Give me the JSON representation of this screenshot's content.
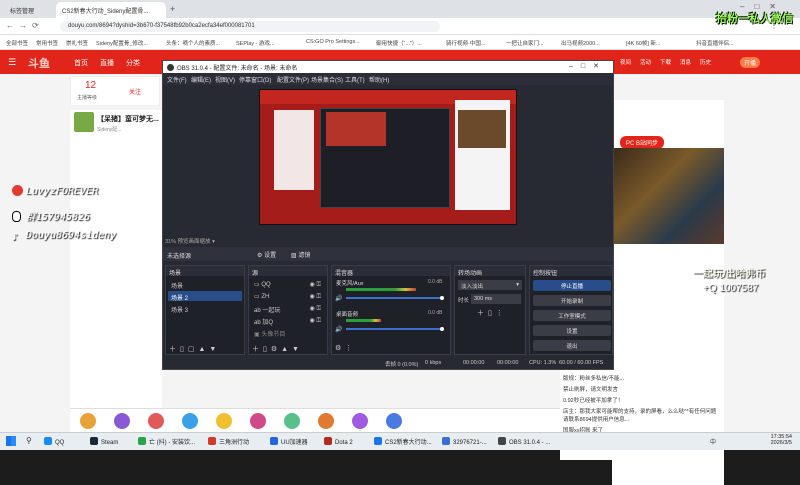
{
  "browser": {
    "tabs": [
      {
        "label": "标签管理"
      },
      {
        "label": "CS2新春大行动_Sideny配置骨..."
      }
    ],
    "url": "douyu.com/8694?dyshid=3b670-f37548fb92b0ca2ecfa34ef000081701",
    "bookmarks": [
      "全部书签",
      "常用书签",
      "崇礼书签",
      "Sideny配置骨_修改...",
      "头条：嘀个人的素质...",
      "SEPlay - 游戏...",
      "CS:GO Pro Settings...",
      "御用快捷（“...”）...",
      "骑行视频·中国...",
      "一把让自家门...",
      "出马视频2000...",
      "[4K 60帧] 新...",
      "抖音直播伴侣..."
    ]
  },
  "site": {
    "logo": "斗鱼",
    "nav": [
      "首页",
      "直播",
      "分类",
      "游戏",
      "原创"
    ],
    "right_nav": [
      "夜间",
      "活动",
      "下载",
      "消息",
      "历史",
      "开播"
    ],
    "pcbl": "PC B站同步",
    "anchor": {
      "level": "12",
      "sub": "主播等级",
      "follow": "关注"
    },
    "stream_title": "【呆猪】蛮可梦无...",
    "anchor_name": "Sideny配..."
  },
  "overlay": {
    "socials": [
      {
        "icon": "netease-music-icon",
        "text": "LuvyzFOREVER"
      },
      {
        "icon": "qq-penguin-icon",
        "text": "群157945826"
      },
      {
        "icon": "tiktok-icon",
        "text": "Douyu8694sideny"
      }
    ],
    "wechat": "拾粉一私人微信",
    "join": "一起玩/出哈弗币",
    "qq": "+Q 1007587"
  },
  "chat": {
    "lines": [
      "1元... 获取成功",
      "版规：粉丝多私信/不能...",
      "禁止刷屏，请文明发言",
      "0.92秒已经被平加拿了！",
      "店主：那我大家可能帮的支持，录的屏看，么么哒^*有任何问题请联系8694提供用户信息...",
      "国服xx招账 来了"
    ]
  },
  "obs": {
    "title": "OBS 31.0.4 - 配置文件: 未命名 - 场景: 未命名",
    "menu": [
      "文件(F)",
      "编辑(E)",
      "视图(V)",
      "停靠窗口(D)",
      "配置文件(P)",
      "场景集合(S)",
      "工具(T)",
      "帮助(H)"
    ],
    "preview_zoom": "31%",
    "preview_zoom_label": "预览画面缩放",
    "no_source": "未选择源",
    "props_btn": "设置",
    "filters_btn": "滤镜",
    "scenes_title": "场景",
    "scenes": [
      "场景",
      "场景 2",
      "场景 3"
    ],
    "selected_scene": 1,
    "sources_title": "源",
    "sources": [
      {
        "label": "QQ",
        "icon": "window-capture-icon"
      },
      {
        "label": "ZH",
        "icon": "window-capture-icon"
      },
      {
        "label": "一起玩",
        "icon": "text-source-icon"
      },
      {
        "label": "加Q",
        "icon": "text-source-icon"
      },
      {
        "label": "头像节目",
        "icon": "image-source-icon"
      }
    ],
    "mixer_title": "混音器",
    "mixer": [
      {
        "label": "麦克风/Aux",
        "db": "0.0 dB",
        "level": 0.7
      },
      {
        "label": "桌面音频",
        "db": "0.0 dB",
        "level": 0.35
      }
    ],
    "transitions_title": "转场动画",
    "transition": "淡入淡出",
    "duration_label": "时长",
    "duration": "300 ms",
    "controls_title": "控制按钮",
    "controls": [
      "停止直播",
      "开始录制",
      "工作室模式",
      "设置",
      "退出"
    ],
    "status": {
      "dropped": "丢帧 0 (0.0%)",
      "kbps": "0 kbps",
      "live_time": "00:00:00",
      "rec_time": "00:00:00",
      "cpu": "CPU: 1.3%",
      "fps": "60.00 / 60.00 FPS"
    }
  },
  "taskbar": {
    "items": [
      {
        "label": "QQ",
        "color": "#1a8bf2"
      },
      {
        "label": "Steam",
        "color": "#1b2838"
      },
      {
        "label": "亡 (抖) - 安装饮...",
        "color": "#2aa44b"
      },
      {
        "label": "三角洲行动",
        "color": "#d33a2a"
      },
      {
        "label": "UU加速器",
        "color": "#2266dd"
      },
      {
        "label": "Dota 2",
        "color": "#b52a1f"
      },
      {
        "label": "CS2新春大行动...",
        "color": "#1a73e8"
      },
      {
        "label": "32976721-...",
        "color": "#3a6fd1"
      },
      {
        "label": "OBS 31.0.4 - ...",
        "color": "#444444"
      }
    ],
    "time": "17:35:54",
    "date": "2026/3/5",
    "lang": "中"
  }
}
